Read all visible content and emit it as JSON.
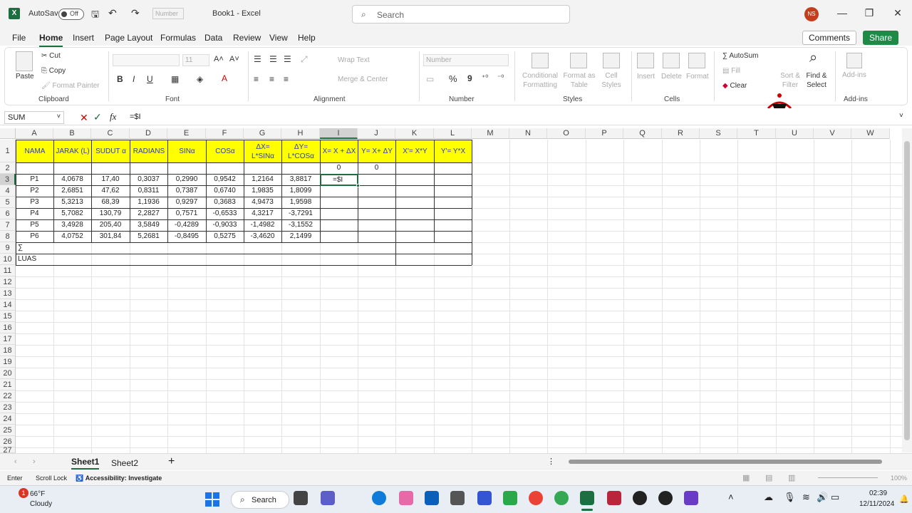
{
  "titlebar": {
    "autosave": "AutoSave",
    "toggle": "Off",
    "numfmt": "Number",
    "title": "Book1  -  Excel",
    "search_placeholder": "Search",
    "avatar": "NS"
  },
  "menu": [
    "File",
    "Home",
    "Insert",
    "Page Layout",
    "Formulas",
    "Data",
    "Review",
    "View",
    "Help"
  ],
  "topbuttons": {
    "comments": "Comments",
    "share": "Share"
  },
  "ribbon": {
    "paste": "Paste",
    "cut": "Cut",
    "copy": "Copy",
    "format_painter": "Format Painter",
    "clipboard": "Clipboard",
    "font_size": "11",
    "bold": "B",
    "italic": "I",
    "underline": "U",
    "font": "Font",
    "wrap": "Wrap Text",
    "merge": "Merge & Center",
    "alignment": "Alignment",
    "number_fmt": "Number",
    "percent": "%",
    "comma": "9",
    "number": "Number",
    "cond_fmt": "Conditional Formatting",
    "fmt_table": "Format as Table",
    "cell_styles": "Cell Styles",
    "styles": "Styles",
    "insert": "Insert",
    "delete": "Delete",
    "format": "Format",
    "cells": "Cells",
    "autosum": "AutoSum",
    "fill": "Fill",
    "clear": "Clear",
    "sort": "Sort & Filter",
    "find": "Find & Select",
    "addins": "Add-ins",
    "addins_grp": "Add-ins"
  },
  "formula": {
    "namebox": "SUM",
    "fx": "fx",
    "content": "=$I"
  },
  "columns": [
    "A",
    "B",
    "C",
    "D",
    "E",
    "F",
    "G",
    "H",
    "I",
    "J",
    "K",
    "L",
    "M",
    "N",
    "O",
    "P",
    "Q",
    "R",
    "S",
    "T",
    "U",
    "V",
    "W"
  ],
  "rows": [
    "1",
    "2",
    "3",
    "4",
    "5",
    "6",
    "7",
    "8",
    "9",
    "10",
    "11",
    "12",
    "13",
    "14",
    "15",
    "16",
    "17",
    "18",
    "19",
    "20",
    "21",
    "22",
    "23",
    "24",
    "25",
    "26",
    "27"
  ],
  "headers": [
    "NAMA",
    "JARAK (L)",
    "SUDUT α",
    "RADIANS",
    "SINα",
    "COSα",
    "ΔX=\nL*SINα",
    "ΔY=\nL*COSα",
    "X= X + ΔX",
    "Y= X+ ΔY",
    "X'= X*Y",
    "Y'= Y*X"
  ],
  "row2": {
    "I": "0",
    "J": "0"
  },
  "data": [
    [
      "P1",
      "4,0678",
      "17,40",
      "0,3037",
      "0,2990",
      "0,9542",
      "1,2164",
      "3,8817"
    ],
    [
      "P2",
      "2,6851",
      "47,62",
      "0,8311",
      "0,7387",
      "0,6740",
      "1,9835",
      "1,8099"
    ],
    [
      "P3",
      "5,3213",
      "68,39",
      "1,1936",
      "0,9297",
      "0,3683",
      "4,9473",
      "1,9598"
    ],
    [
      "P4",
      "5,7082",
      "130,79",
      "2,2827",
      "0,7571",
      "-0,6533",
      "4,3217",
      "-3,7291"
    ],
    [
      "P5",
      "3,4928",
      "205,40",
      "3,5849",
      "-0,4289",
      "-0,9033",
      "-1,4982",
      "-3,1552"
    ],
    [
      "P6",
      "4,0752",
      "301,84",
      "5,2681",
      "-0,8495",
      "0,5275",
      "-3,4620",
      "2,1499"
    ]
  ],
  "editing_cell": "=$I",
  "sum_label": "∑",
  "luas_label": "LUAS",
  "sheets": [
    "Sheet1",
    "Sheet2"
  ],
  "status": {
    "mode": "Enter",
    "scroll": "Scroll Lock",
    "access": "Accessibility: Investigate",
    "zoom": "100%"
  },
  "taskbar": {
    "temp": "66°F",
    "weather": "Cloudy",
    "badge": "1",
    "search": "Search",
    "time": "02:39",
    "date": "12/11/2024"
  }
}
